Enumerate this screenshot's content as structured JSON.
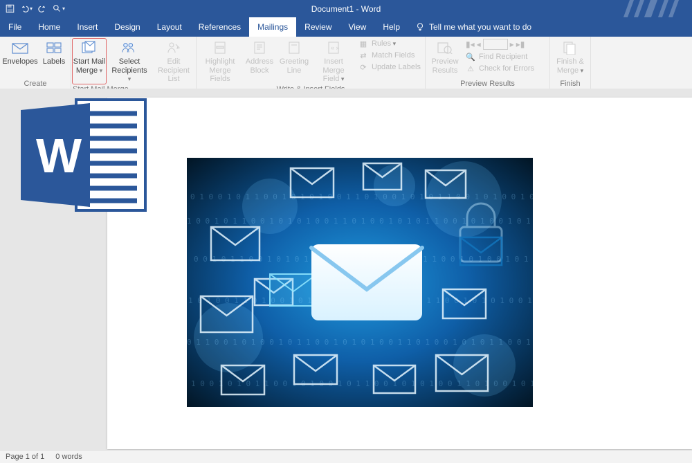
{
  "title": "Document1 - Word",
  "qat": {
    "save": "save-icon",
    "undo": "undo-icon",
    "redo": "redo-icon",
    "touch": "touch-mode-icon"
  },
  "tabs": {
    "file": "File",
    "home": "Home",
    "insert": "Insert",
    "design": "Design",
    "layout": "Layout",
    "references": "References",
    "mailings": "Mailings",
    "review": "Review",
    "view": "View",
    "help": "Help"
  },
  "active_tab": "mailings",
  "tell_me": "Tell me what you want to do",
  "ribbon": {
    "create": {
      "label": "Create",
      "envelopes": "Envelopes",
      "labels": "Labels"
    },
    "start": {
      "label": "Start Mail Merge",
      "start_mail_merge_l1": "Start Mail",
      "start_mail_merge_l2": "Merge",
      "select_recipients_l1": "Select",
      "select_recipients_l2": "Recipients",
      "edit_recipient_l1": "Edit",
      "edit_recipient_l2": "Recipient List"
    },
    "write": {
      "label": "Write & Insert Fields",
      "highlight_l1": "Highlight",
      "highlight_l2": "Merge Fields",
      "address_l1": "Address",
      "address_l2": "Block",
      "greeting_l1": "Greeting",
      "greeting_l2": "Line",
      "insert_l1": "Insert Merge",
      "insert_l2": "Field",
      "rules": "Rules",
      "match": "Match Fields",
      "update": "Update Labels"
    },
    "preview": {
      "label": "Preview Results",
      "preview_l1": "Preview",
      "preview_l2": "Results",
      "find": "Find Recipient",
      "errors": "Check for Errors"
    },
    "finish": {
      "label": "Finish",
      "finish_l1": "Finish &",
      "finish_l2": "Merge"
    }
  },
  "status": {
    "page": "Page 1 of 1",
    "words": "0 words"
  }
}
